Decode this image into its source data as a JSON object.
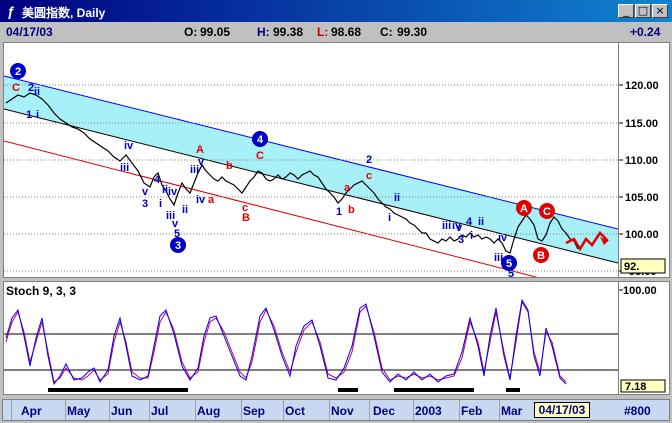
{
  "window": {
    "title_symbol": "ƒ",
    "title": "美圆指数, Daily",
    "buttons": [
      "_",
      "□",
      "×"
    ]
  },
  "infobar": {
    "date": "04/17/03",
    "open_label": "O:",
    "open": "99.05",
    "high_label": "H:",
    "high": "99.38",
    "low_label": "L:",
    "low": "98.68",
    "close_label": "C:",
    "close": "99.30",
    "change": "+0.24"
  },
  "price_scale": {
    "ticks": [
      "120.00",
      "115.00",
      "110.00",
      "105.00",
      "100.00",
      "95.00"
    ],
    "last_value": "92."
  },
  "stoch": {
    "label": "Stoch 9, 3, 3",
    "scale_top": "100.00",
    "scale_bottom": "7.18"
  },
  "time_axis": {
    "months": [
      "Apr",
      "May",
      "Jun",
      "Jul",
      "Aug",
      "Sep",
      "Oct",
      "Nov",
      "Dec",
      "2003",
      "Feb",
      "Mar"
    ],
    "current_date": "04/17/03",
    "bar_count": "#800"
  },
  "wave_labels": {
    "circle_2": "2",
    "circle_3": "3",
    "circle_4": "4",
    "circle_5": "5",
    "circle_A": "A",
    "circle_B": "B",
    "circle_C": "C"
  },
  "colors": {
    "channel_fill": "#a8f0f8",
    "upper_line": "#0000ff",
    "lower_line": "#e00000",
    "wave_blue": "#0000c0",
    "wave_red": "#e00000",
    "stoch_k": "#0000ff",
    "stoch_d": "#c00060"
  }
}
